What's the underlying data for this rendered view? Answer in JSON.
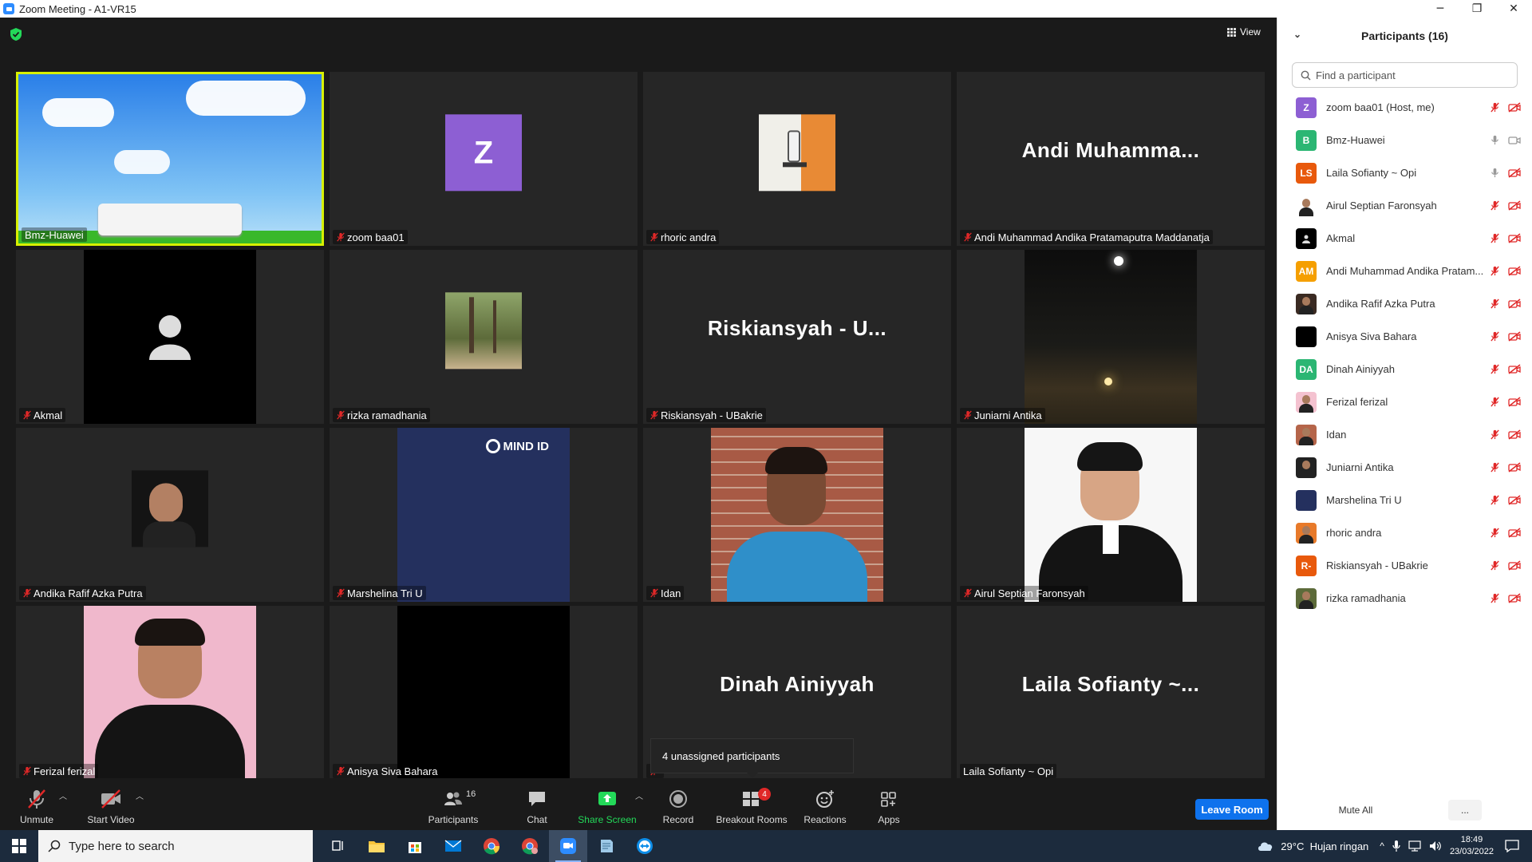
{
  "window": {
    "title": "Zoom Meeting - A1-VR15",
    "controls": {
      "minimize": "─",
      "restore": "❐",
      "close": "✕"
    }
  },
  "meeting": {
    "view_label": "View",
    "tiles": [
      {
        "name": "Bmz-Huawei",
        "type": "video-sky",
        "muted": false,
        "active": true
      },
      {
        "name": "zoom baa01",
        "type": "initial",
        "initial": "Z",
        "color": "#8d5fd3",
        "muted": true
      },
      {
        "name": "rhoric andra",
        "type": "photo-office",
        "muted": true
      },
      {
        "name": "Andi Muhammad Andika Pratamaputra Maddanatja",
        "type": "big-name",
        "big": "Andi  Muhamma...",
        "muted": true
      },
      {
        "name": "Akmal",
        "type": "video-person-icon",
        "muted": true
      },
      {
        "name": "rizka ramadhania",
        "type": "photo-forest",
        "muted": true
      },
      {
        "name": "Riskiansyah - UBakrie",
        "type": "big-name",
        "big": "Riskiansyah - U...",
        "muted": true
      },
      {
        "name": "Juniarni Antika",
        "type": "video-moon",
        "muted": true
      },
      {
        "name": "Andika Rafif Azka Putra",
        "type": "photo-dark",
        "muted": true
      },
      {
        "name": "Marshelina Tri U",
        "type": "video-mindid",
        "logo": "MIND ID",
        "muted": true
      },
      {
        "name": "Idan",
        "type": "video-brick",
        "muted": true
      },
      {
        "name": "Airul Septian Faronsyah",
        "type": "video-suit",
        "muted": true
      },
      {
        "name": "Ferizal ferizal",
        "type": "video-pink",
        "muted": true
      },
      {
        "name": "Anisya Siva Bahara",
        "type": "video-black",
        "muted": true
      },
      {
        "name": "",
        "type": "big-name",
        "big": "Dinah Ainiyyah",
        "muted": true
      },
      {
        "name": "Laila Sofianty ~ Opi",
        "type": "big-name",
        "big": "Laila Sofianty ~...",
        "muted": false
      }
    ],
    "popup": "4 unassigned participants"
  },
  "toolbar": {
    "unmute": "Unmute",
    "start_video": "Start Video",
    "participants": "Participants",
    "participants_count": "16",
    "chat": "Chat",
    "share_screen": "Share Screen",
    "record": "Record",
    "breakout_rooms": "Breakout Rooms",
    "breakout_badge": "4",
    "reactions": "Reactions",
    "apps": "Apps",
    "leave": "Leave Room",
    "share_color": "#23d959"
  },
  "panel": {
    "title": "Participants (16)",
    "search_placeholder": "Find a participant",
    "mute_all": "Mute All",
    "more": "...",
    "participants": [
      {
        "name": "zoom baa01 (Host, me)",
        "initials": "Z",
        "color": "#8d5fd3",
        "mic": "off",
        "cam": "off"
      },
      {
        "name": "Bmz-Huawei",
        "initials": "B",
        "color": "#2bb673",
        "mic": "on",
        "cam": "on"
      },
      {
        "name": "Laila Sofianty ~ Opi",
        "initials": "LS",
        "color": "#e8590c",
        "mic": "on",
        "cam": "off"
      },
      {
        "name": "Airul Septian Faronsyah",
        "initials": "",
        "color": "#ffffff",
        "photo": "suit",
        "mic": "off",
        "cam": "off"
      },
      {
        "name": "Akmal",
        "initials": "",
        "color": "#000000",
        "photo": "person",
        "mic": "off",
        "cam": "off"
      },
      {
        "name": "Andi Muhammad Andika Pratam...",
        "initials": "AM",
        "color": "#f59f00",
        "mic": "off",
        "cam": "off"
      },
      {
        "name": "Andika Rafif Azka Putra",
        "initials": "",
        "color": "#3a2a22",
        "photo": "dark",
        "mic": "off",
        "cam": "off"
      },
      {
        "name": "Anisya Siva Bahara",
        "initials": "",
        "color": "#000000",
        "mic": "off",
        "cam": "off"
      },
      {
        "name": "Dinah Ainiyyah",
        "initials": "DA",
        "color": "#2bb673",
        "mic": "off",
        "cam": "off"
      },
      {
        "name": "Ferizal ferizal",
        "initials": "",
        "color": "#f4c2d0",
        "photo": "pink",
        "mic": "off",
        "cam": "off"
      },
      {
        "name": "Idan",
        "initials": "",
        "color": "#b5654a",
        "photo": "brick",
        "mic": "off",
        "cam": "off"
      },
      {
        "name": "Juniarni Antika",
        "initials": "",
        "color": "#222222",
        "photo": "moon",
        "mic": "off",
        "cam": "off"
      },
      {
        "name": "Marshelina Tri U",
        "initials": "",
        "color": "#24305e",
        "mic": "off",
        "cam": "off"
      },
      {
        "name": "rhoric andra",
        "initials": "",
        "color": "#e87a2a",
        "photo": "office",
        "mic": "off",
        "cam": "off"
      },
      {
        "name": "Riskiansyah - UBakrie",
        "initials": "R-",
        "color": "#e8590c",
        "mic": "off",
        "cam": "off"
      },
      {
        "name": "rizka ramadhania",
        "initials": "",
        "color": "#5d6b3a",
        "photo": "forest",
        "mic": "off",
        "cam": "off"
      }
    ]
  },
  "taskbar": {
    "search_placeholder": "Type here to search",
    "weather": "29°C  Hujan ringan",
    "time": "18:49",
    "date": "23/03/2022",
    "caret": "^"
  }
}
